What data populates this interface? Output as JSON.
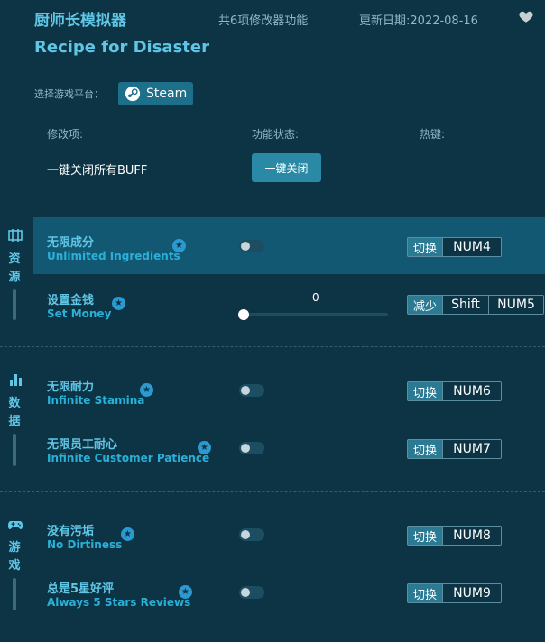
{
  "header": {
    "title_cn": "厨师长模拟器",
    "func_count": "共6项修改器功能",
    "update_date": "更新日期:2022-08-16",
    "title_en": "Recipe for Disaster"
  },
  "platform": {
    "label": "选择游戏平台：",
    "steam_label": "Steam"
  },
  "columns": {
    "option": "修改项:",
    "status": "功能状态:",
    "hotkey": "热键:"
  },
  "close_all": {
    "label": "一键关闭所有BUFF",
    "button": "一键关闭"
  },
  "sidebar": {
    "resources": {
      "c1": "资",
      "c2": "源"
    },
    "data": {
      "c1": "数",
      "c2": "据"
    },
    "game": {
      "c1": "游",
      "c2": "戏"
    }
  },
  "options": [
    {
      "cn": "无限成分",
      "en": "Unlimited Ingredients",
      "action": "切换",
      "key": "NUM4",
      "enabled": false
    },
    {
      "cn": "设置金钱",
      "en": "Set Money",
      "action": "减少",
      "key1": "Shift",
      "key2": "NUM5",
      "slider_value": "0"
    },
    {
      "cn": "无限耐力",
      "en": "Infinite Stamina",
      "action": "切换",
      "key": "NUM6",
      "enabled": false
    },
    {
      "cn": "无限员工耐心",
      "en": "Infinite Customer Patience",
      "action": "切换",
      "key": "NUM7",
      "enabled": false
    },
    {
      "cn": "没有污垢",
      "en": "No Dirtiness",
      "action": "切换",
      "key": "NUM8",
      "enabled": false
    },
    {
      "cn": "总是5星好评",
      "en": "Always 5 Stars Reviews",
      "action": "切换",
      "key": "NUM9",
      "enabled": false
    }
  ],
  "colors": {
    "background": "#0d3445",
    "accent": "#5fc6e6",
    "highlight_row": "#135873",
    "button": "#2a8aa5"
  },
  "icons": {
    "favorite": "heart-icon",
    "steam": "steam-icon",
    "star": "star-icon"
  }
}
